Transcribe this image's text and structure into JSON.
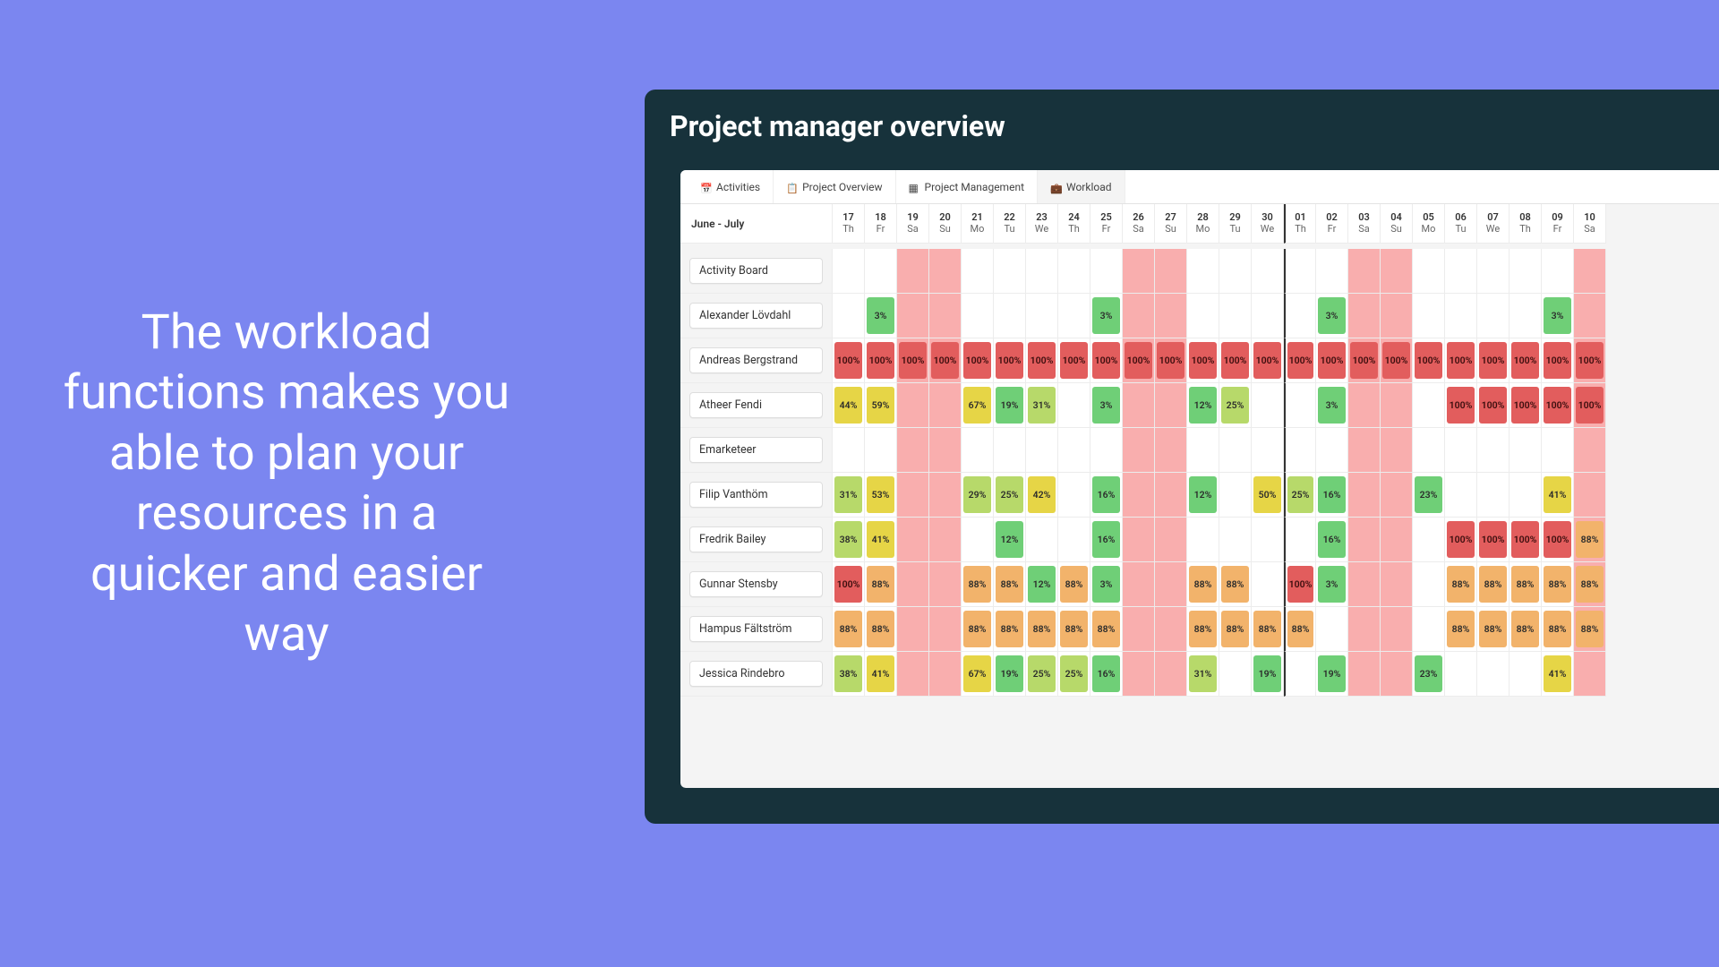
{
  "marketing_headline": "The workload functions makes you able to plan your resources in a quicker and easier way",
  "window": {
    "title": "Project manager overview"
  },
  "tabs": [
    {
      "label": "Activities",
      "icon": "cal",
      "active": false
    },
    {
      "label": "Project Overview",
      "icon": "clip",
      "active": false
    },
    {
      "label": "Project Management",
      "icon": "grid",
      "active": false
    },
    {
      "label": "Workload",
      "icon": "bag",
      "active": true
    }
  ],
  "timeline": {
    "month_label": "June - July",
    "days": [
      {
        "num": "17",
        "dow": "Th",
        "weekend": false
      },
      {
        "num": "18",
        "dow": "Fr",
        "weekend": false
      },
      {
        "num": "19",
        "dow": "Sa",
        "weekend": true
      },
      {
        "num": "20",
        "dow": "Su",
        "weekend": true
      },
      {
        "num": "21",
        "dow": "Mo",
        "weekend": false
      },
      {
        "num": "22",
        "dow": "Tu",
        "weekend": false
      },
      {
        "num": "23",
        "dow": "We",
        "weekend": false
      },
      {
        "num": "24",
        "dow": "Th",
        "weekend": false
      },
      {
        "num": "25",
        "dow": "Fr",
        "weekend": false
      },
      {
        "num": "26",
        "dow": "Sa",
        "weekend": true
      },
      {
        "num": "27",
        "dow": "Su",
        "weekend": true
      },
      {
        "num": "28",
        "dow": "Mo",
        "weekend": false
      },
      {
        "num": "29",
        "dow": "Tu",
        "weekend": false
      },
      {
        "num": "30",
        "dow": "We",
        "weekend": false
      },
      {
        "num": "01",
        "dow": "Th",
        "weekend": false,
        "month_start": true
      },
      {
        "num": "02",
        "dow": "Fr",
        "weekend": false
      },
      {
        "num": "03",
        "dow": "Sa",
        "weekend": true
      },
      {
        "num": "04",
        "dow": "Su",
        "weekend": true
      },
      {
        "num": "05",
        "dow": "Mo",
        "weekend": false
      },
      {
        "num": "06",
        "dow": "Tu",
        "weekend": false
      },
      {
        "num": "07",
        "dow": "We",
        "weekend": false
      },
      {
        "num": "08",
        "dow": "Th",
        "weekend": false
      },
      {
        "num": "09",
        "dow": "Fr",
        "weekend": false
      },
      {
        "num": "10",
        "dow": "Sa",
        "weekend": true
      }
    ]
  },
  "rows": [
    {
      "name": "Activity Board",
      "cells": [
        null,
        null,
        null,
        null,
        null,
        null,
        null,
        null,
        null,
        null,
        null,
        null,
        null,
        null,
        null,
        null,
        null,
        null,
        null,
        null,
        null,
        null,
        null,
        null
      ]
    },
    {
      "name": "Alexander Lövdahl",
      "cells": [
        null,
        "3%",
        null,
        null,
        null,
        null,
        null,
        null,
        "3%",
        null,
        null,
        null,
        null,
        null,
        null,
        "3%",
        null,
        null,
        null,
        null,
        null,
        null,
        "3%",
        null
      ]
    },
    {
      "name": "Andreas Bergstrand",
      "cells": [
        "100%",
        "100%",
        "100%",
        "100%",
        "100%",
        "100%",
        "100%",
        "100%",
        "100%",
        "100%",
        "100%",
        "100%",
        "100%",
        "100%",
        "100%",
        "100%",
        "100%",
        "100%",
        "100%",
        "100%",
        "100%",
        "100%",
        "100%",
        "100%"
      ]
    },
    {
      "name": "Atheer Fendi",
      "cells": [
        "44%",
        "59%",
        null,
        null,
        "67%",
        "19%",
        "31%",
        null,
        "3%",
        null,
        null,
        "12%",
        "25%",
        null,
        null,
        "3%",
        null,
        null,
        null,
        "100%",
        "100%",
        "100%",
        "100%",
        "100%"
      ]
    },
    {
      "name": "Emarketeer",
      "cells": [
        null,
        null,
        null,
        null,
        null,
        null,
        null,
        null,
        null,
        null,
        null,
        null,
        null,
        null,
        null,
        null,
        null,
        null,
        null,
        null,
        null,
        null,
        null,
        null
      ]
    },
    {
      "name": "Filip Vanthöm",
      "cells": [
        "31%",
        "53%",
        null,
        null,
        "29%",
        "25%",
        "42%",
        null,
        "16%",
        null,
        null,
        "12%",
        null,
        "50%",
        "25%",
        "16%",
        null,
        null,
        "23%",
        null,
        null,
        null,
        "41%",
        null
      ]
    },
    {
      "name": "Fredrik Bailey",
      "cells": [
        "38%",
        "41%",
        null,
        null,
        null,
        "12%",
        null,
        null,
        "16%",
        null,
        null,
        null,
        null,
        null,
        null,
        "16%",
        null,
        null,
        null,
        "100%",
        "100%",
        "100%",
        "100%",
        "88%"
      ]
    },
    {
      "name": "Gunnar Stensby",
      "cells": [
        "100%",
        "88%",
        null,
        null,
        "88%",
        "88%",
        "12%",
        "88%",
        "3%",
        null,
        null,
        "88%",
        "88%",
        null,
        "100%",
        "3%",
        null,
        null,
        null,
        "88%",
        "88%",
        "88%",
        "88%",
        "88%"
      ]
    },
    {
      "name": "Hampus Fältström",
      "cells": [
        "88%",
        "88%",
        null,
        null,
        "88%",
        "88%",
        "88%",
        "88%",
        "88%",
        null,
        null,
        "88%",
        "88%",
        "88%",
        "88%",
        null,
        null,
        null,
        null,
        "88%",
        "88%",
        "88%",
        "88%",
        "88%"
      ]
    },
    {
      "name": "Jessica Rindebro",
      "cells": [
        "38%",
        "41%",
        null,
        null,
        "67%",
        "19%",
        "25%",
        "25%",
        "16%",
        null,
        null,
        "31%",
        null,
        "19%",
        null,
        "19%",
        null,
        null,
        "23%",
        null,
        null,
        null,
        "41%",
        null
      ]
    }
  ],
  "colors": {
    "bg": "#7b86f0",
    "app_bg": "#17323b",
    "weekend": "#f9aeae",
    "red": "#e25d5d",
    "orange": "#f2b36b",
    "yellow": "#e6d546",
    "lime": "#b7d96a",
    "green": "#6fcf77"
  }
}
